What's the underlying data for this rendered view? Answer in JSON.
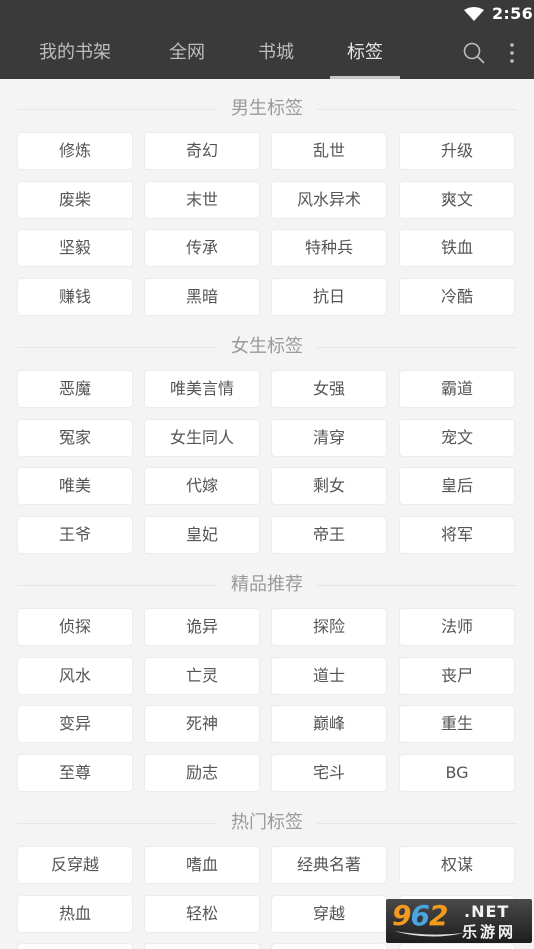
{
  "status_bar": {
    "time": "2:56",
    "wifi_icon": "wifi-icon"
  },
  "app_bar": {
    "tabs": [
      {
        "label": "我的书架",
        "active": false
      },
      {
        "label": "全网",
        "active": false
      },
      {
        "label": "书城",
        "active": false
      },
      {
        "label": "标签",
        "active": true
      }
    ],
    "search_icon": "search-icon",
    "more_icon": "more-vert-icon"
  },
  "sections": [
    {
      "title": "男生标签",
      "tags": [
        "修炼",
        "奇幻",
        "乱世",
        "升级",
        "废柴",
        "末世",
        "风水异术",
        "爽文",
        "坚毅",
        "传承",
        "特种兵",
        "铁血",
        "赚钱",
        "黑暗",
        "抗日",
        "冷酷"
      ]
    },
    {
      "title": "女生标签",
      "tags": [
        "恶魔",
        "唯美言情",
        "女强",
        "霸道",
        "冤家",
        "女生同人",
        "清穿",
        "宠文",
        "唯美",
        "代嫁",
        "剩女",
        "皇后",
        "王爷",
        "皇妃",
        "帝王",
        "将军"
      ]
    },
    {
      "title": "精品推荐",
      "tags": [
        "侦探",
        "诡异",
        "探险",
        "法师",
        "风水",
        "亡灵",
        "道士",
        "丧尸",
        "变异",
        "死神",
        "巅峰",
        "重生",
        "至尊",
        "励志",
        "宅斗",
        "BG"
      ]
    },
    {
      "title": "热门标签",
      "tags": [
        "反穿越",
        "嗜血",
        "经典名著",
        "权谋",
        "热血",
        "轻松",
        "穿越",
        "",
        "",
        "",
        "",
        ""
      ]
    }
  ],
  "watermark": {
    "number_part1": "9",
    "number_part2": "6",
    "number_part3": "2",
    "domain": ".NET",
    "site_name": "乐游网"
  },
  "colors": {
    "app_bar_bg": "#3a3a3a",
    "page_bg": "#f4f4f4",
    "tag_bg": "#ffffff",
    "tag_text": "#555555",
    "section_title": "#9a9a9a"
  }
}
